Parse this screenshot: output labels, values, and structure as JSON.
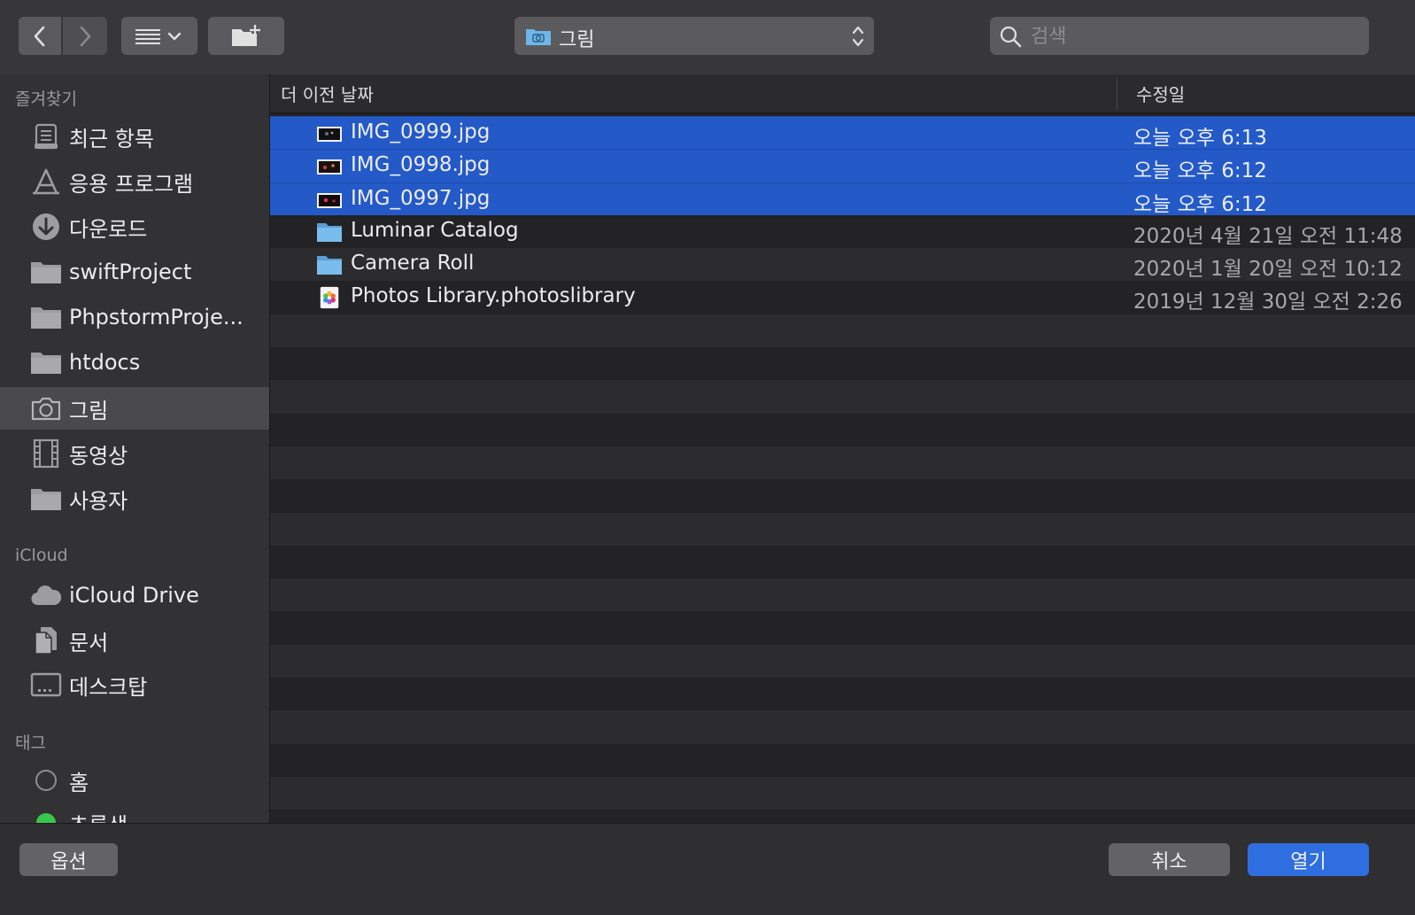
{
  "toolbar": {
    "back_icon": "chevron-left",
    "forward_icon": "chevron-right",
    "view_icon": "list-view",
    "new_folder_icon": "new-folder",
    "location_label": "그림",
    "search_placeholder": "검색"
  },
  "sidebar": {
    "favorites_title": "즐겨찾기",
    "favorites": [
      {
        "label": "최근 항목",
        "icon": "recents-icon"
      },
      {
        "label": "응용 프로그램",
        "icon": "applications-icon"
      },
      {
        "label": "다운로드",
        "icon": "downloads-icon"
      },
      {
        "label": "swiftProject",
        "icon": "folder-icon"
      },
      {
        "label": "PhpstormProje...",
        "icon": "folder-icon"
      },
      {
        "label": "htdocs",
        "icon": "folder-icon"
      },
      {
        "label": "그림",
        "icon": "camera-icon",
        "selected": true
      },
      {
        "label": "동영상",
        "icon": "film-icon"
      },
      {
        "label": "사용자",
        "icon": "folder-icon"
      }
    ],
    "icloud_title": "iCloud",
    "icloud": [
      {
        "label": "iCloud Drive",
        "icon": "cloud-icon"
      },
      {
        "label": "문서",
        "icon": "document-icon"
      },
      {
        "label": "데스크탑",
        "icon": "desktop-icon"
      }
    ],
    "tags_title": "태그",
    "tags": [
      {
        "label": "홈",
        "color": "#2a2a2c"
      },
      {
        "label": "초록색",
        "color": "#3ac64a"
      }
    ]
  },
  "list": {
    "header_name": "더 이전 날짜",
    "header_date": "수정일",
    "files": [
      {
        "name": "IMG_0999.jpg",
        "date": "오늘 오후 6:13",
        "type": "image",
        "selected": true
      },
      {
        "name": "IMG_0998.jpg",
        "date": "오늘 오후 6:12",
        "type": "image",
        "selected": true
      },
      {
        "name": "IMG_0997.jpg",
        "date": "오늘 오후 6:12",
        "type": "image",
        "selected": true
      },
      {
        "name": "Luminar Catalog",
        "date": "2020년 4월 21일 오전 11:48",
        "type": "folder",
        "selected": false
      },
      {
        "name": "Camera Roll",
        "date": "2020년 1월 20일 오전 10:12",
        "type": "folder",
        "selected": false
      },
      {
        "name": "Photos Library.photoslibrary",
        "date": "2019년 12월 30일 오전 2:26",
        "type": "photos-library",
        "selected": false
      }
    ]
  },
  "buttons": {
    "options": "옵션",
    "cancel": "취소",
    "open": "열기"
  },
  "colors": {
    "selection": "#2459c8",
    "primary_button": "#2f6ee0",
    "folder_blue": "#6fb5e8"
  }
}
